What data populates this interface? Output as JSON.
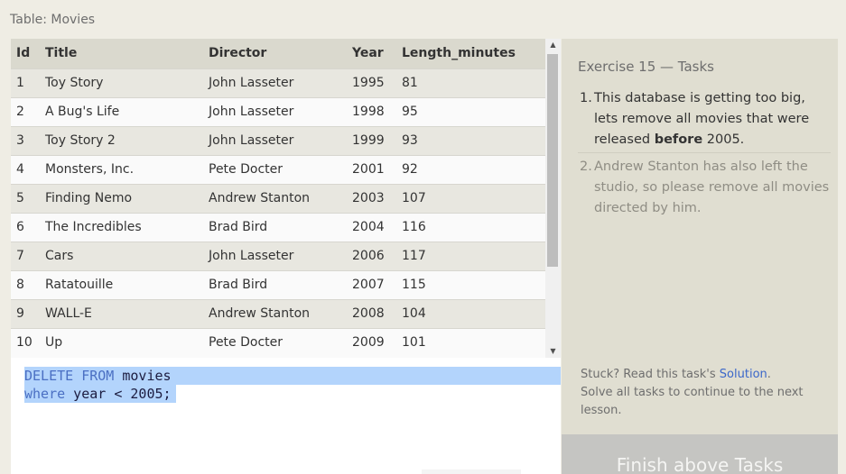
{
  "table_caption": "Table: Movies",
  "table": {
    "headers": [
      "Id",
      "Title",
      "Director",
      "Year",
      "Length_minutes"
    ],
    "rows": [
      [
        "1",
        "Toy Story",
        "John Lasseter",
        "1995",
        "81"
      ],
      [
        "2",
        "A Bug's Life",
        "John Lasseter",
        "1998",
        "95"
      ],
      [
        "3",
        "Toy Story 2",
        "John Lasseter",
        "1999",
        "93"
      ],
      [
        "4",
        "Monsters, Inc.",
        "Pete Docter",
        "2001",
        "92"
      ],
      [
        "5",
        "Finding Nemo",
        "Andrew Stanton",
        "2003",
        "107"
      ],
      [
        "6",
        "The Incredibles",
        "Brad Bird",
        "2004",
        "116"
      ],
      [
        "7",
        "Cars",
        "John Lasseter",
        "2006",
        "117"
      ],
      [
        "8",
        "Ratatouille",
        "Brad Bird",
        "2007",
        "115"
      ],
      [
        "9",
        "WALL-E",
        "Andrew Stanton",
        "2008",
        "104"
      ],
      [
        "10",
        "Up",
        "Pete Docter",
        "2009",
        "101"
      ]
    ],
    "scroll_up_icon": "scroll-up-arrow-icon",
    "scroll_down_icon": "scroll-down-arrow-icon"
  },
  "editor": {
    "line1": {
      "keyword": "DELETE FROM",
      "rest": " movies"
    },
    "line2": {
      "keyword": "where",
      "rest": " year < 2005;"
    },
    "selection_color": "#b3d4fc"
  },
  "tasks": {
    "title": "Exercise 15 — Tasks",
    "items": [
      {
        "num": "1.",
        "pre": "This database is getting too big, lets remove all movies that were released ",
        "bold": "before",
        "post": " 2005."
      },
      {
        "num": "2.",
        "text": "Andrew Stanton has also left the studio, so please remove all movies directed by him."
      }
    ],
    "stuck": {
      "prefix": "Stuck? Read this task's ",
      "link": "Solution",
      "suffix": ".",
      "line2": "Solve all tasks to continue to the next lesson."
    },
    "finish_button": "Finish above Tasks"
  },
  "colors": {
    "background": "#efede4",
    "header_row": "#dad9ce",
    "tasks_panel": "#e0ded1",
    "link": "#3b67c9",
    "finish_button": "#c5c5c2"
  }
}
